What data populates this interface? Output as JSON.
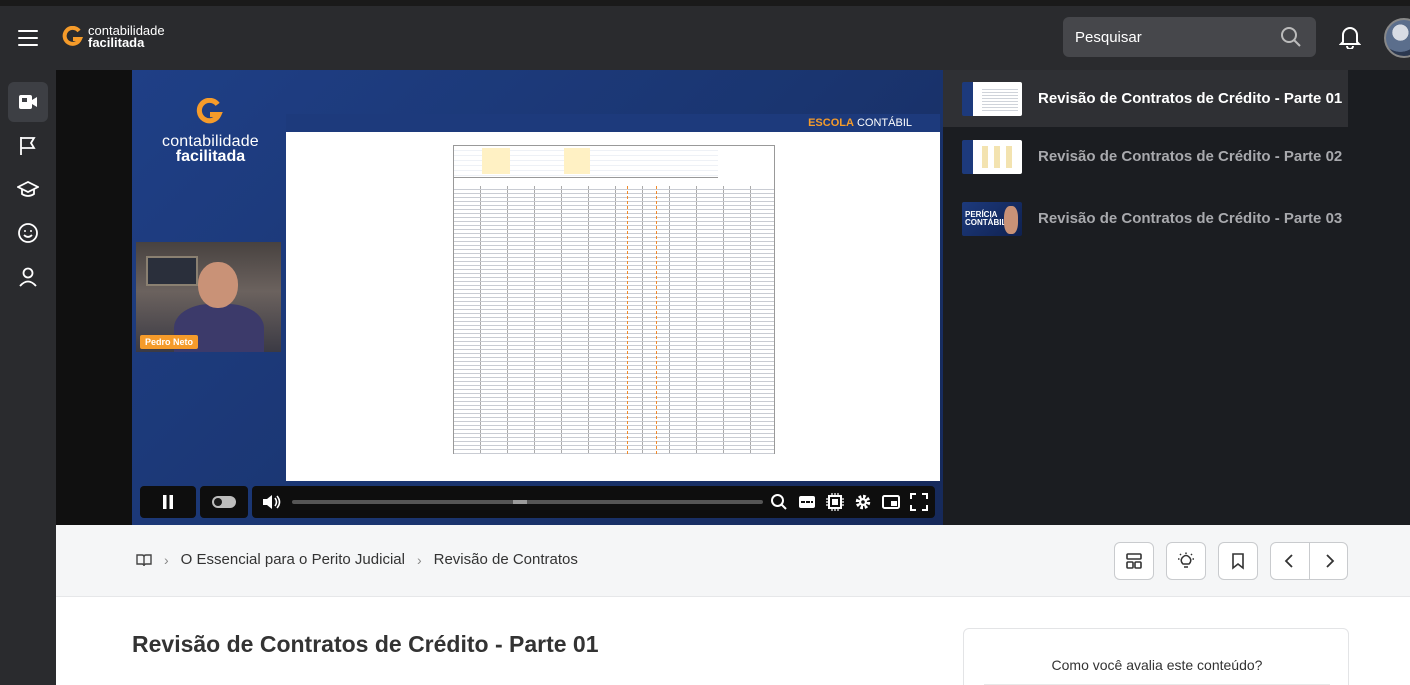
{
  "brand": {
    "line1": "contabilidade",
    "line2": "facilitada",
    "accent": "#f59b2a"
  },
  "search": {
    "placeholder": "Pesquisar"
  },
  "video": {
    "slide_brand_bold": "ESCOLA",
    "slide_brand_rest": " CONTÁBIL",
    "presenter": "Pedro Neto",
    "progress_fraction": 0.0
  },
  "playlist": [
    {
      "title": "Revisão de Contratos de Crédito - Parte 01",
      "active": true
    },
    {
      "title": "Revisão de Contratos de Crédito - Parte 02",
      "active": false
    },
    {
      "title": "Revisão de Contratos de Crédito - Parte 03",
      "active": false
    }
  ],
  "thumb3": {
    "line1": "PERÍCIA",
    "line2": "CONTÁBIL"
  },
  "breadcrumb": {
    "course": "O Essencial para o Perito Judicial",
    "module": "Revisão de Contratos"
  },
  "lesson": {
    "title": "Revisão de Contratos de Crédito - Parte 01"
  },
  "rating": {
    "question": "Como você avalia este conteúdo?"
  }
}
